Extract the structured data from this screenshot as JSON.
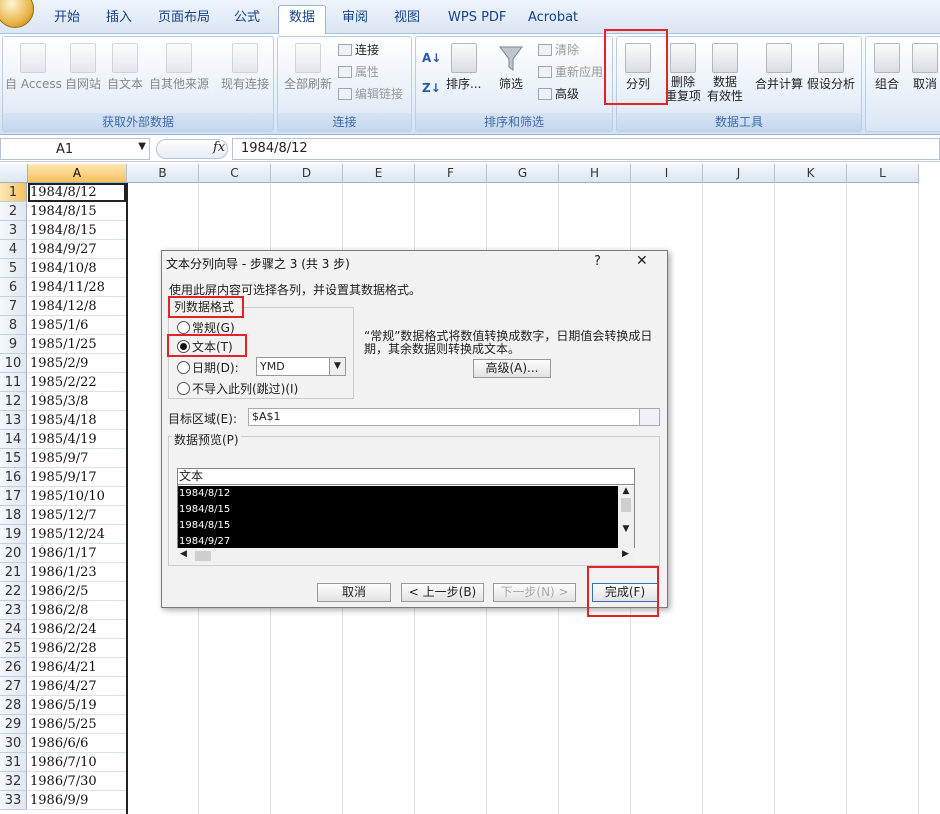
{
  "tabs": [
    "开始",
    "插入",
    "页面布局",
    "公式",
    "数据",
    "审阅",
    "视图",
    "WPS PDF",
    "Acrobat"
  ],
  "active_tab": "数据",
  "ribbon": {
    "get_external": {
      "label": "获取外部数据",
      "access": "自 Access",
      "web": "自网站",
      "text": "自文本",
      "other": "自其他来源",
      "existing": "现有连接"
    },
    "connections": {
      "label": "连接",
      "refresh_all": "全部刷新",
      "connections": "连接",
      "properties": "属性",
      "edit_links": "编辑链接"
    },
    "sort_filter": {
      "label": "排序和筛选",
      "sort": "排序...",
      "filter": "筛选",
      "clear": "清除",
      "reapply": "重新应用",
      "advanced": "高级"
    },
    "data_tools": {
      "label": "数据工具",
      "split": "分列",
      "remove_dup_1": "删除",
      "remove_dup_2": "重复项",
      "validation_1": "数据",
      "validation_2": "有效性",
      "consolidate": "合并计算",
      "whatif": "假设分析"
    },
    "outline": {
      "group": "组合",
      "ungroup": "取消"
    }
  },
  "formula_bar": {
    "name_box": "A1",
    "fx": "fx",
    "formula": "1984/8/12"
  },
  "columns": [
    "A",
    "B",
    "C",
    "D",
    "E",
    "F",
    "G",
    "H",
    "I",
    "J",
    "K",
    "L"
  ],
  "rows": [
    {
      "n": "1",
      "a": "1984/8/12"
    },
    {
      "n": "2",
      "a": "1984/8/15"
    },
    {
      "n": "3",
      "a": "1984/8/15"
    },
    {
      "n": "4",
      "a": "1984/9/27"
    },
    {
      "n": "5",
      "a": "1984/10/8"
    },
    {
      "n": "6",
      "a": "1984/11/28"
    },
    {
      "n": "7",
      "a": "1984/12/8"
    },
    {
      "n": "8",
      "a": "1985/1/6"
    },
    {
      "n": "9",
      "a": "1985/1/25"
    },
    {
      "n": "10",
      "a": "1985/2/9"
    },
    {
      "n": "11",
      "a": "1985/2/22"
    },
    {
      "n": "12",
      "a": "1985/3/8"
    },
    {
      "n": "13",
      "a": "1985/4/18"
    },
    {
      "n": "14",
      "a": "1985/4/19"
    },
    {
      "n": "15",
      "a": "1985/9/7"
    },
    {
      "n": "16",
      "a": "1985/9/17"
    },
    {
      "n": "17",
      "a": "1985/10/10"
    },
    {
      "n": "18",
      "a": "1985/12/7"
    },
    {
      "n": "19",
      "a": "1985/12/24"
    },
    {
      "n": "20",
      "a": "1986/1/17"
    },
    {
      "n": "21",
      "a": "1986/1/23"
    },
    {
      "n": "22",
      "a": "1986/2/5"
    },
    {
      "n": "23",
      "a": "1986/2/8"
    },
    {
      "n": "24",
      "a": "1986/2/24"
    },
    {
      "n": "25",
      "a": "1986/2/28"
    },
    {
      "n": "26",
      "a": "1986/4/21"
    },
    {
      "n": "27",
      "a": "1986/4/27"
    },
    {
      "n": "28",
      "a": "1986/5/19"
    },
    {
      "n": "29",
      "a": "1986/5/25"
    },
    {
      "n": "30",
      "a": "1986/6/6"
    },
    {
      "n": "31",
      "a": "1986/7/10"
    },
    {
      "n": "32",
      "a": "1986/7/30"
    },
    {
      "n": "33",
      "a": "1986/9/9"
    }
  ],
  "dialog": {
    "title": "文本分列向导 - 步骤之 3 (共 3 步)",
    "help": "?",
    "close": "✕",
    "instruction": "使用此屏内容可选择各列，并设置其数据格式。",
    "format_group": "列数据格式",
    "opt_general": "常规(G)",
    "opt_text": "文本(T)",
    "opt_date": "日期(D):",
    "date_value": "YMD",
    "opt_skip": "不导入此列(跳过)(I)",
    "desc": "“常规”数据格式将数值转换成数字，日期值会转换成日期，其余数据则转换成文本。",
    "advanced": "高级(A)...",
    "dest_label": "目标区域(E):",
    "dest_value": "$A$1",
    "preview_label": "数据预览(P)",
    "preview_header": "文本",
    "preview_rows": [
      "1984/8/12",
      "1984/8/15",
      "1984/8/15",
      "1984/9/27"
    ],
    "btn_cancel": "取消",
    "btn_back": "< 上一步(B)",
    "btn_next": "下一步(N) >",
    "btn_finish": "完成(F)"
  },
  "colors": {
    "highlight": "#e4222a",
    "selected_header": "#f7c25e",
    "tab_text": "#15428b"
  }
}
